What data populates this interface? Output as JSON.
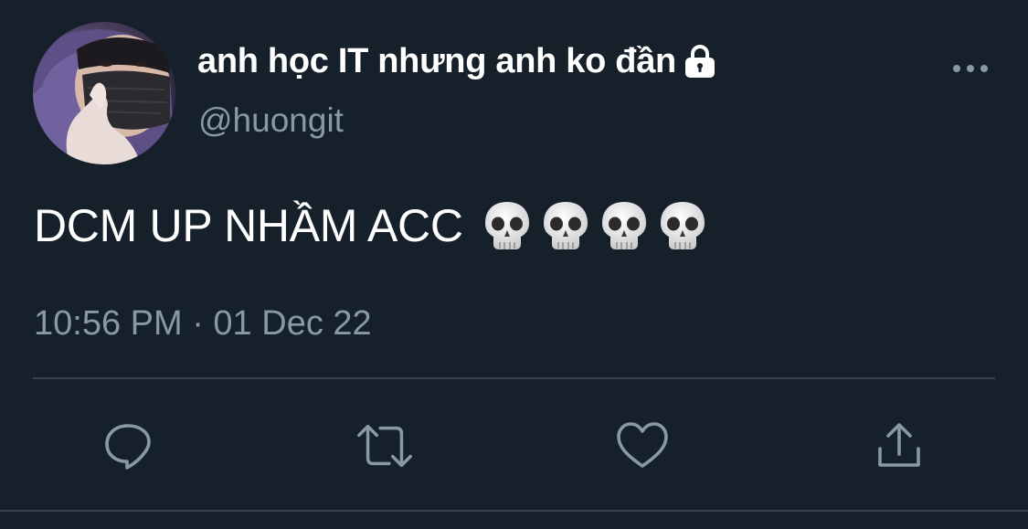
{
  "user": {
    "display_name": "anh học IT nhưng anh ko đần",
    "handle": "@huongit",
    "protected_icon": "lock-icon",
    "avatar": "profile-photo"
  },
  "tweet": {
    "text": "DCM UP NHẦM ACC",
    "emoji": [
      "skull",
      "skull",
      "skull",
      "skull"
    ],
    "timestamp": "10:56 PM · 01 Dec 22"
  },
  "actions": [
    {
      "name": "reply",
      "icon": "speech-bubble-icon"
    },
    {
      "name": "retweet",
      "icon": "retweet-icon"
    },
    {
      "name": "like",
      "icon": "heart-icon"
    },
    {
      "name": "share",
      "icon": "share-icon"
    }
  ],
  "more_icon": "more-dots-icon",
  "colors": {
    "background": "#15202b",
    "text": "#ffffff",
    "secondary_text": "#8899a6",
    "divider": "#38444d"
  }
}
